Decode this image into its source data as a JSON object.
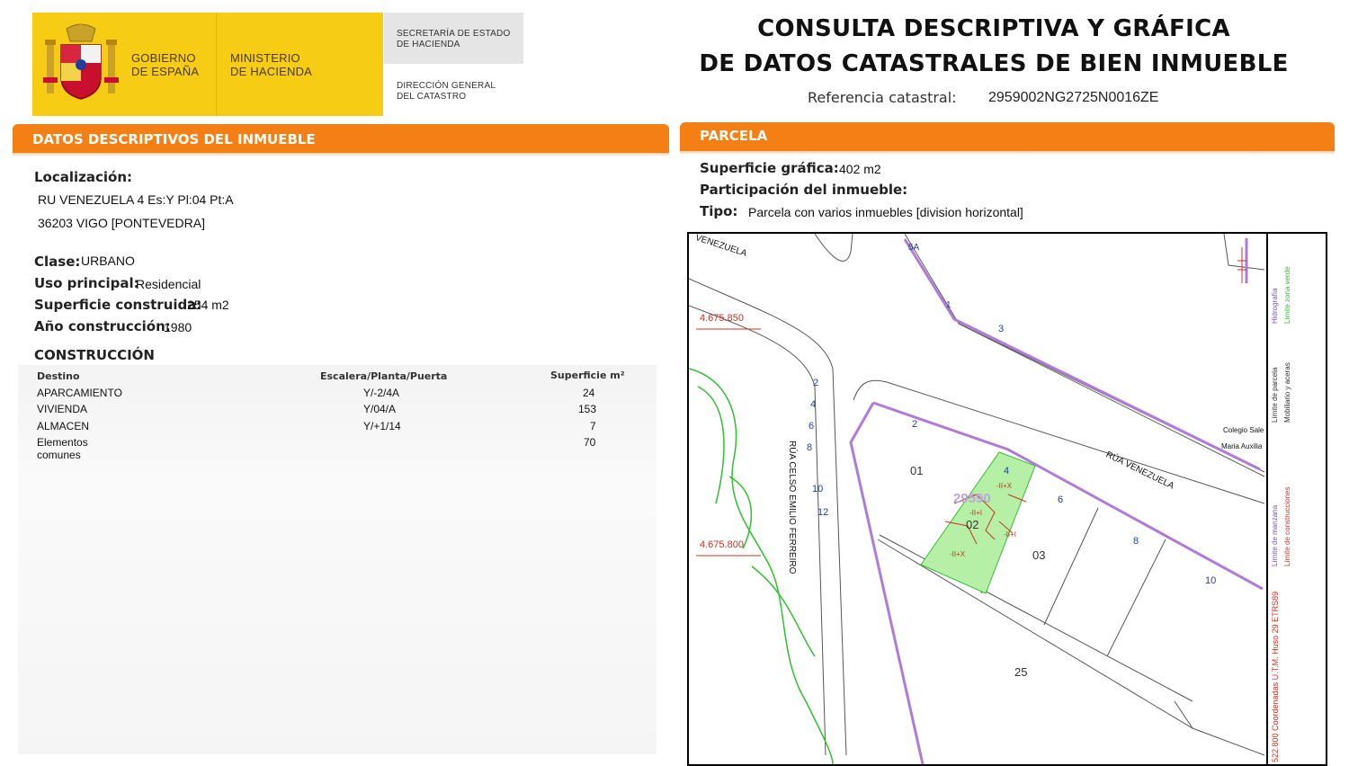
{
  "header": {
    "gov_line1": "GOBIERNO",
    "gov_line2": "DE ESPAÑA",
    "min_line1": "MINISTERIO",
    "min_line2": "DE HACIENDA",
    "secr_line1": "SECRETARÍA DE ESTADO",
    "secr_line2": "DE HACIENDA",
    "dir_line1": "DIRECCIÓN GENERAL",
    "dir_line2": "DEL CATASTRO",
    "title_line1": "CONSULTA DESCRIPTIVA Y GRÁFICA",
    "title_line2": "DE DATOS CATASTRALES DE BIEN INMUEBLE",
    "ref_label": "Referencia catastral:",
    "ref_value": "2959002NG2725N0016ZE"
  },
  "descriptivos": {
    "section_title": "DATOS DESCRIPTIVOS DEL INMUEBLE",
    "localizacion_label": "Localización:",
    "address_line1": "RU VENEZUELA 4 Es:Y Pl:04 Pt:A",
    "address_line2": "36203 VIGO [PONTEVEDRA]",
    "clase_label": "Clase:",
    "clase_value": "URBANO",
    "uso_label": "Uso principal:",
    "uso_value": "Residencial",
    "superficie_label": "Superficie construida:",
    "superficie_value": "254 m2",
    "anio_label": "Año construcción:",
    "anio_value": "1980",
    "construccion_title": "CONSTRUCCIÓN",
    "table": {
      "headers": [
        "Destino",
        "Escalera/Planta/Puerta",
        "Superficie m²"
      ],
      "rows": [
        [
          "APARCAMIENTO",
          "Y/-2/4A",
          "24"
        ],
        [
          "VIVIENDA",
          "Y/04/A",
          "153"
        ],
        [
          "ALMACEN",
          "Y/+1/14",
          "7"
        ],
        [
          "Elementos comunes",
          "",
          "70"
        ]
      ]
    }
  },
  "parcela": {
    "section_title": "PARCELA",
    "sup_label": "Superficie gráfica:",
    "sup_value": "402 m2",
    "part_label": "Participación del inmueble:",
    "tipo_label": "Tipo:",
    "tipo_value": "Parcela con varios inmuebles [division horizontal]",
    "map": {
      "coord_top": "4.675.850",
      "coord_bottom": "4.675.800",
      "street_venezuela_top": "VENEZUELA",
      "street_venezuela": "RÚA VENEZUELA",
      "street_celso": "RÚA CELSO EMILIO FERREIRO",
      "parcel_code": "29590",
      "sub_01": "01",
      "sub_02": "02",
      "sub_03": "03",
      "sub_25": "25",
      "num_5a": "5A",
      "num_1a": "1",
      "num_3": "3",
      "num_2a": "2",
      "num_4a": "4",
      "num_6a": "6",
      "num_8a": "8",
      "num_10a": "10",
      "num_12": "12",
      "num_2b": "2",
      "num_4b": "4",
      "num_6b": "6",
      "num_8b": "8",
      "num_10b": "10",
      "floor_a": "-II+X",
      "floor_b": "-II+I",
      "floor_c": "-II+I",
      "floor_d": "-II+X",
      "colegio_1": "Colegio Sale",
      "colegio_2": "Maria Auxilia",
      "legend": {
        "parcela": "Límite de parcela",
        "hidrografia": "Hidrografía",
        "mobiliario": "Mobiliario y aceras",
        "zona_verde": "Límite zona verde",
        "manzana": "Límite de manzana",
        "construcciones": "Límite de construcciones",
        "coords": "522.800 Coordenadas U.T.M. Huso 29 ETRS89"
      }
    }
  },
  "colors": {
    "accent_orange": "#f47f14",
    "gov_yellow": "#f7cc14",
    "parcel_purple": "#b07ad8",
    "green_zone": "#2fbf2f",
    "building_red": "#d03020"
  }
}
